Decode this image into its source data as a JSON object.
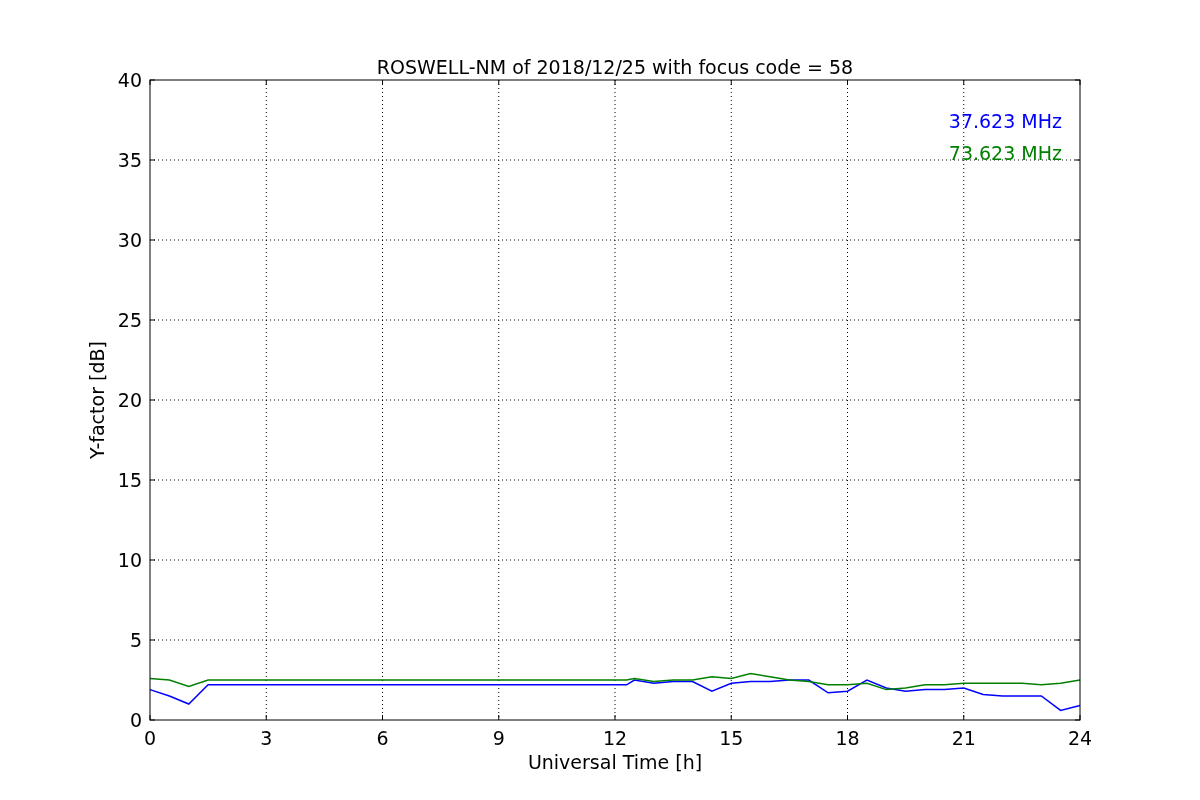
{
  "figure": {
    "chart_data": {
      "type": "line",
      "title": "ROSWELL-NM of 2018/12/25 with focus code = 58",
      "xlabel": "Universal Time [h]",
      "ylabel": "Y-factor [dB]",
      "x": [
        0,
        0.5,
        1,
        1.5,
        3,
        6,
        9,
        12.3,
        12.5,
        13,
        13.5,
        14,
        14.5,
        15,
        15.5,
        16,
        16.5,
        17,
        17.5,
        18,
        18.5,
        19,
        19.5,
        20,
        20.5,
        21,
        21.5,
        22,
        22.5,
        23,
        23.5,
        24
      ],
      "series": [
        {
          "name": "37.623 MHz",
          "color": "#0000ff",
          "values": [
            1.9,
            1.5,
            1.0,
            2.2,
            2.2,
            2.2,
            2.2,
            2.2,
            2.5,
            2.3,
            2.4,
            2.4,
            1.8,
            2.3,
            2.4,
            2.4,
            2.5,
            2.5,
            1.7,
            1.8,
            2.5,
            2.0,
            1.8,
            1.9,
            1.9,
            2.0,
            1.6,
            1.5,
            1.5,
            1.5,
            0.6,
            0.9
          ]
        },
        {
          "name": "73.623 MHz",
          "color": "#008000",
          "values": [
            2.6,
            2.5,
            2.1,
            2.5,
            2.5,
            2.5,
            2.5,
            2.5,
            2.6,
            2.4,
            2.5,
            2.5,
            2.7,
            2.6,
            2.9,
            2.7,
            2.5,
            2.4,
            2.2,
            2.2,
            2.3,
            1.9,
            2.0,
            2.2,
            2.2,
            2.3,
            2.3,
            2.3,
            2.3,
            2.2,
            2.3,
            2.5
          ]
        }
      ],
      "xlim": [
        0,
        24
      ],
      "ylim": [
        0,
        40
      ],
      "xticks": [
        0,
        3,
        6,
        9,
        12,
        15,
        18,
        21,
        24
      ],
      "yticks": [
        0,
        5,
        10,
        15,
        20,
        25,
        30,
        35,
        40
      ],
      "grid": true
    }
  }
}
